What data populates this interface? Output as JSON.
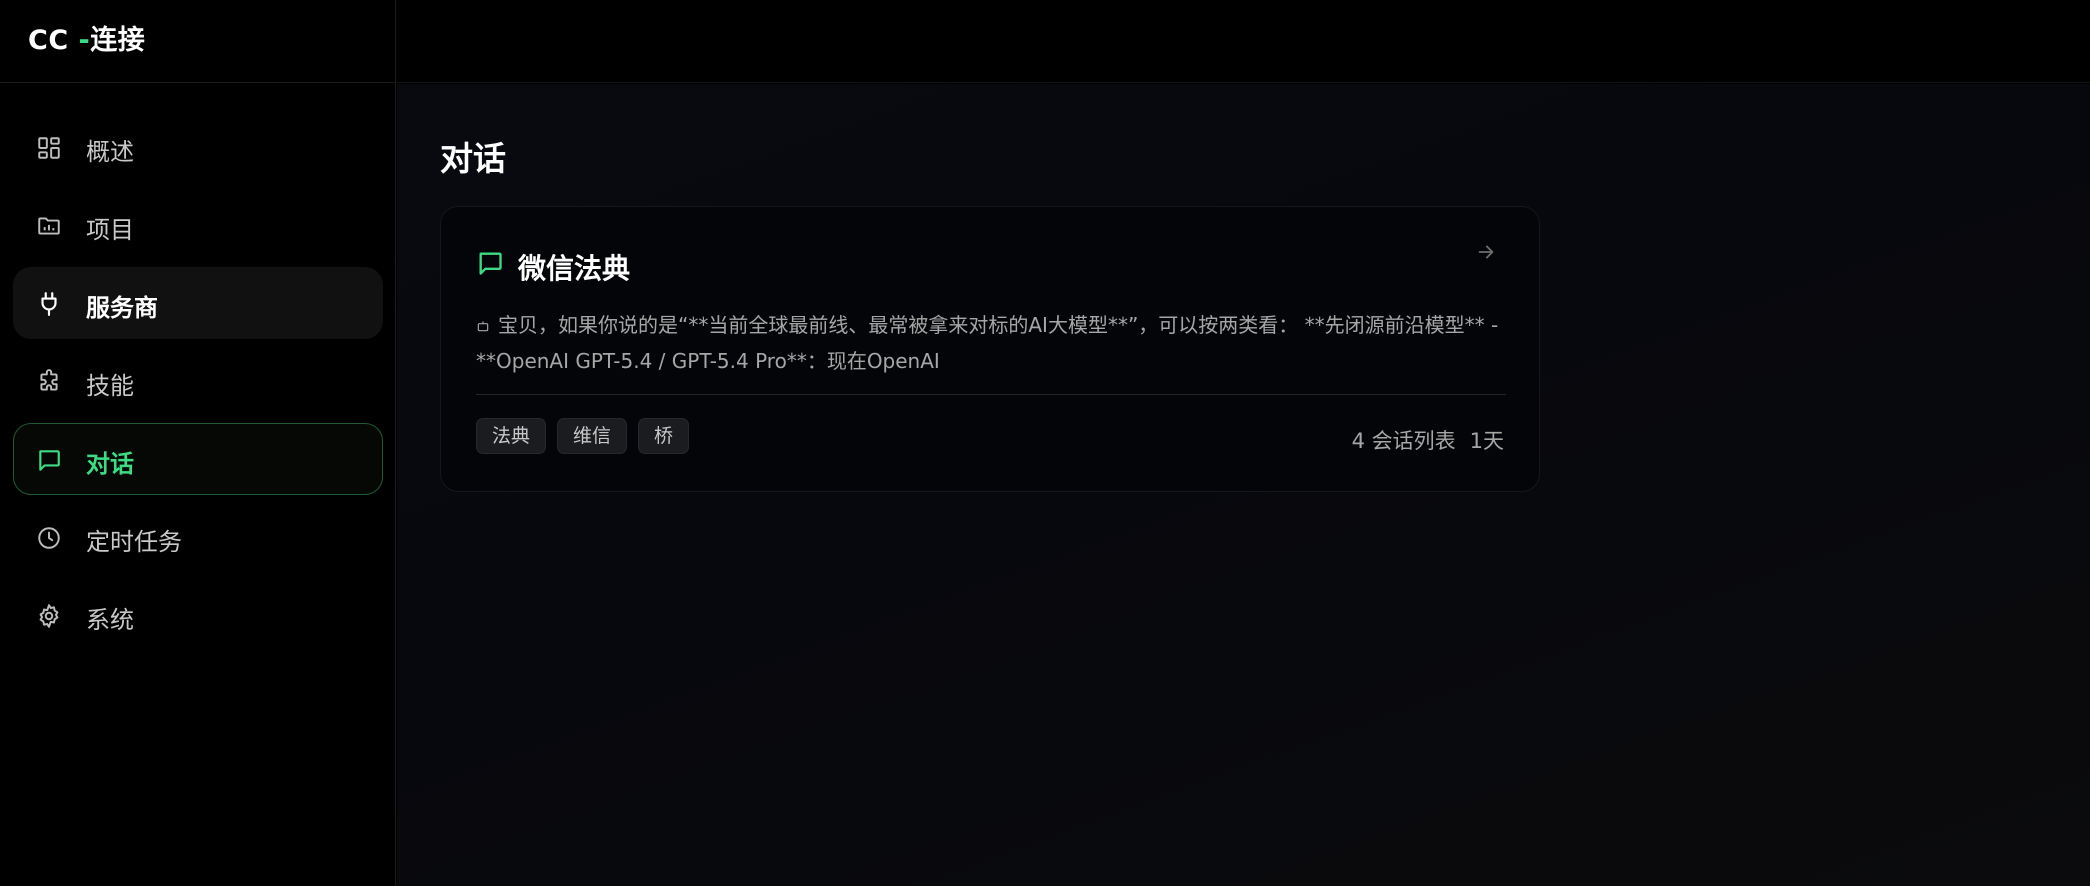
{
  "brand": {
    "prefix": "CC ",
    "dash": "-",
    "suffix": "连接"
  },
  "nav": [
    {
      "label": "概述",
      "icon": "dashboard-grid-icon"
    },
    {
      "label": "项目",
      "icon": "folder-icon"
    },
    {
      "label": "服务商",
      "icon": "plug-icon"
    },
    {
      "label": "技能",
      "icon": "puzzle-icon"
    },
    {
      "label": "对话",
      "icon": "chat-bubble-icon"
    },
    {
      "label": "定时任务",
      "icon": "clock-icon"
    },
    {
      "label": "系统",
      "icon": "gear-icon"
    }
  ],
  "page": {
    "title": "对话"
  },
  "conversation": {
    "title": "微信法典",
    "preview": "宝贝，如果你说的是“**当前全球最前线、最常被拿来对标的AI大模型**”，可以按两类看： **先闭源前沿模型** - **OpenAI GPT-5.4 / GPT-5.4 Pro**：现在OpenAI",
    "tags": [
      "法典",
      "维信",
      "桥"
    ],
    "session_count": "4 会话列表",
    "age": "1天"
  },
  "colors": {
    "accent": "#3ddc84",
    "background": "#000000",
    "card": "#040508"
  }
}
